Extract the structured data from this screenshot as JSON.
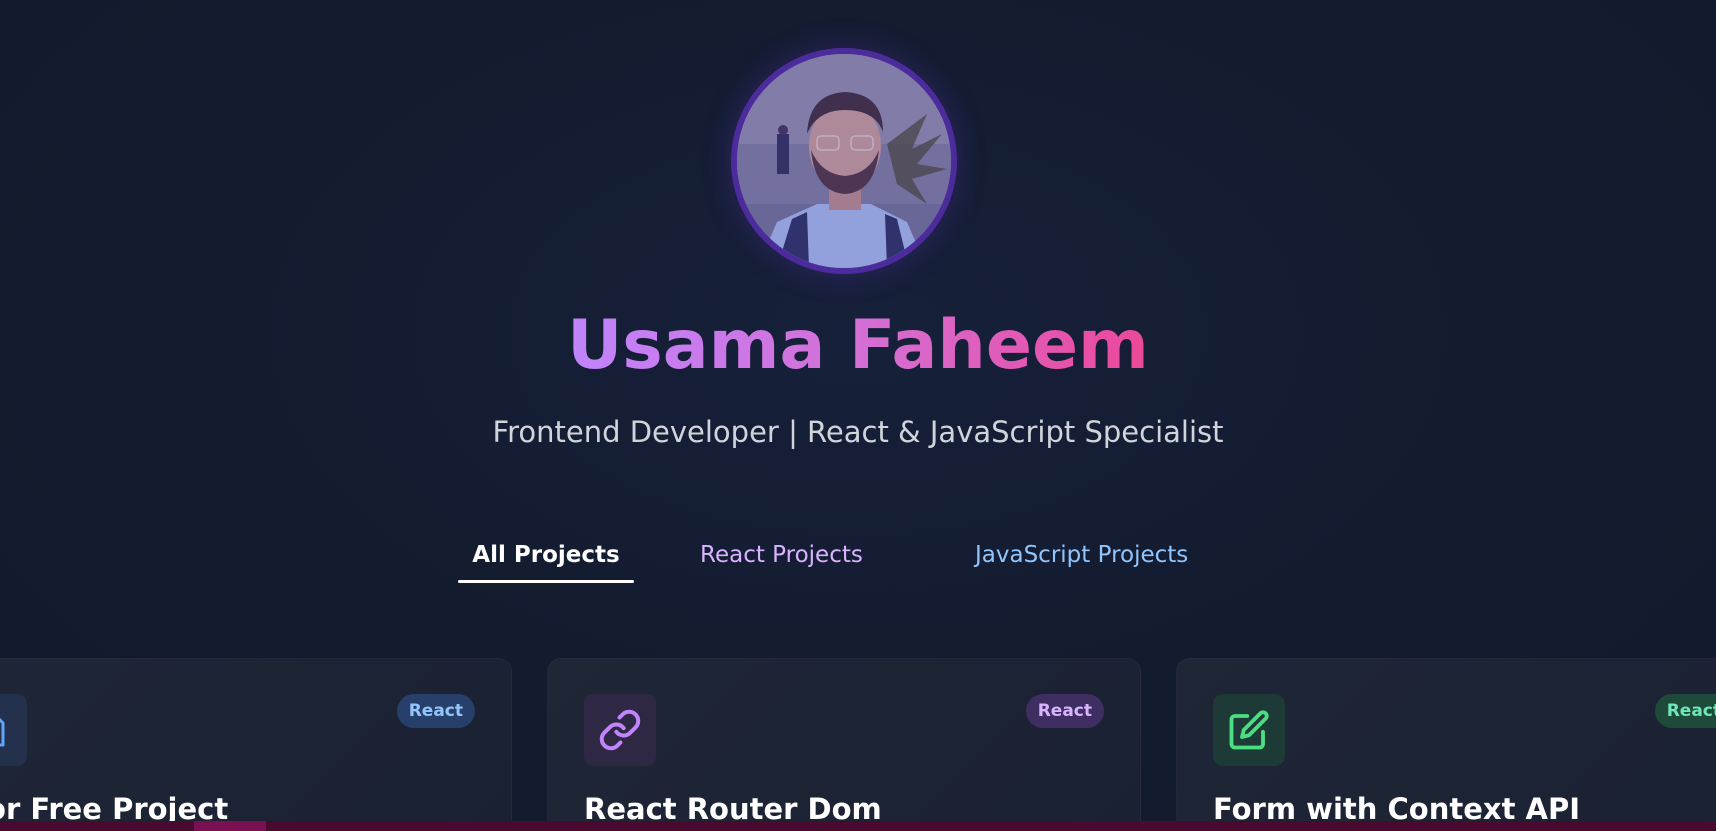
{
  "profile": {
    "avatar_alt": "Usama Faheem profile photo",
    "name": "Usama Faheem",
    "subtitle": "Frontend Developer | React & JavaScript Specialist"
  },
  "tabs": [
    {
      "label": "All Projects",
      "active": true
    },
    {
      "label": "React Projects",
      "active": false
    },
    {
      "label": "JavaScript Projects",
      "active": false
    }
  ],
  "projects": [
    {
      "title": "ctor Free Project",
      "badge": "React",
      "icon": "document-icon",
      "accent": "#60a5fa"
    },
    {
      "title": "React Router Dom",
      "badge": "React",
      "icon": "link-icon",
      "accent": "#c084fc"
    },
    {
      "title": "Form with Context API",
      "badge": "React",
      "icon": "edit-icon",
      "accent": "#4ade80"
    }
  ],
  "colors": {
    "background": "#131b2e",
    "name_gradient_start": "#c084fc",
    "name_gradient_end": "#ec4899",
    "card_bg": "#1e2535"
  }
}
